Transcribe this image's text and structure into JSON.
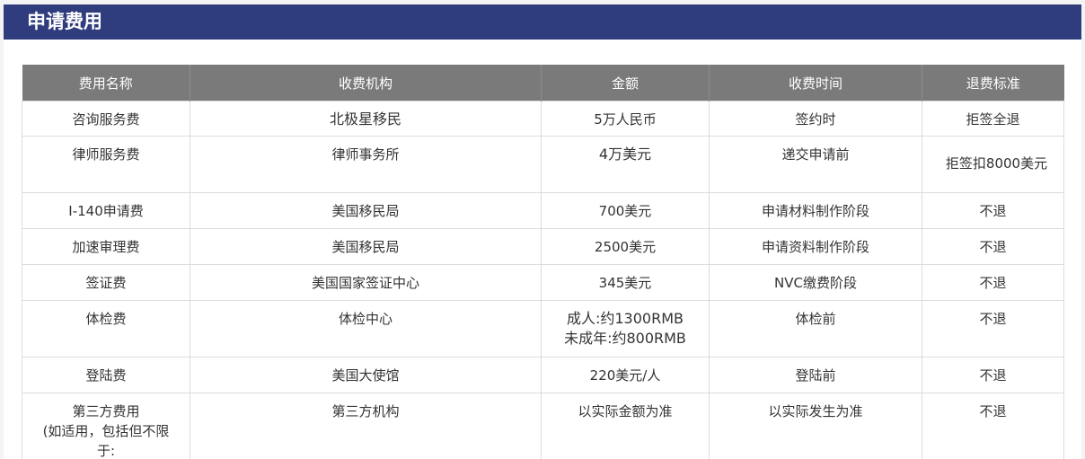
{
  "section_title": "申请费用",
  "table": {
    "headers": [
      "费用名称",
      "收费机构",
      "金额",
      "收费时间",
      "退费标准"
    ],
    "rows": [
      {
        "name": "咨询服务费",
        "agency": "北极星移民",
        "amount": "5万人民币",
        "time": "签约时",
        "refund": "拒签全退"
      },
      {
        "name": "律师服务费",
        "agency": "律师事务所",
        "amount": "4万美元",
        "time": "递交申请前",
        "refund": "拒签扣8000美元"
      },
      {
        "name": "I-140申请费",
        "agency": "美国移民局",
        "amount": "700美元",
        "time": "申请材料制作阶段",
        "refund": "不退"
      },
      {
        "name": "加速审理费",
        "agency": "美国移民局",
        "amount": "2500美元",
        "time": "申请资料制作阶段",
        "refund": "不退"
      },
      {
        "name": "签证费",
        "agency": "美国国家签证中心",
        "amount": "345美元",
        "time": "NVC缴费阶段",
        "refund": "不退"
      },
      {
        "name": "体检费",
        "agency": "体检中心",
        "amount_line1": "成人:约1300RMB",
        "amount_line2": "未成年:约800RMB",
        "time": "体检前",
        "refund": "不退"
      },
      {
        "name": "登陆费",
        "agency": "美国大使馆",
        "amount": "220美元/人",
        "time": "登陆前",
        "refund": "不退"
      },
      {
        "name_line1": "第三方费用",
        "name_line2": "(如适用，包括但不限",
        "name_line3": "于:",
        "agency": "第三方机构",
        "amount": "以实际金额为准",
        "time": "以实际发生为准",
        "refund": "不退"
      }
    ]
  }
}
